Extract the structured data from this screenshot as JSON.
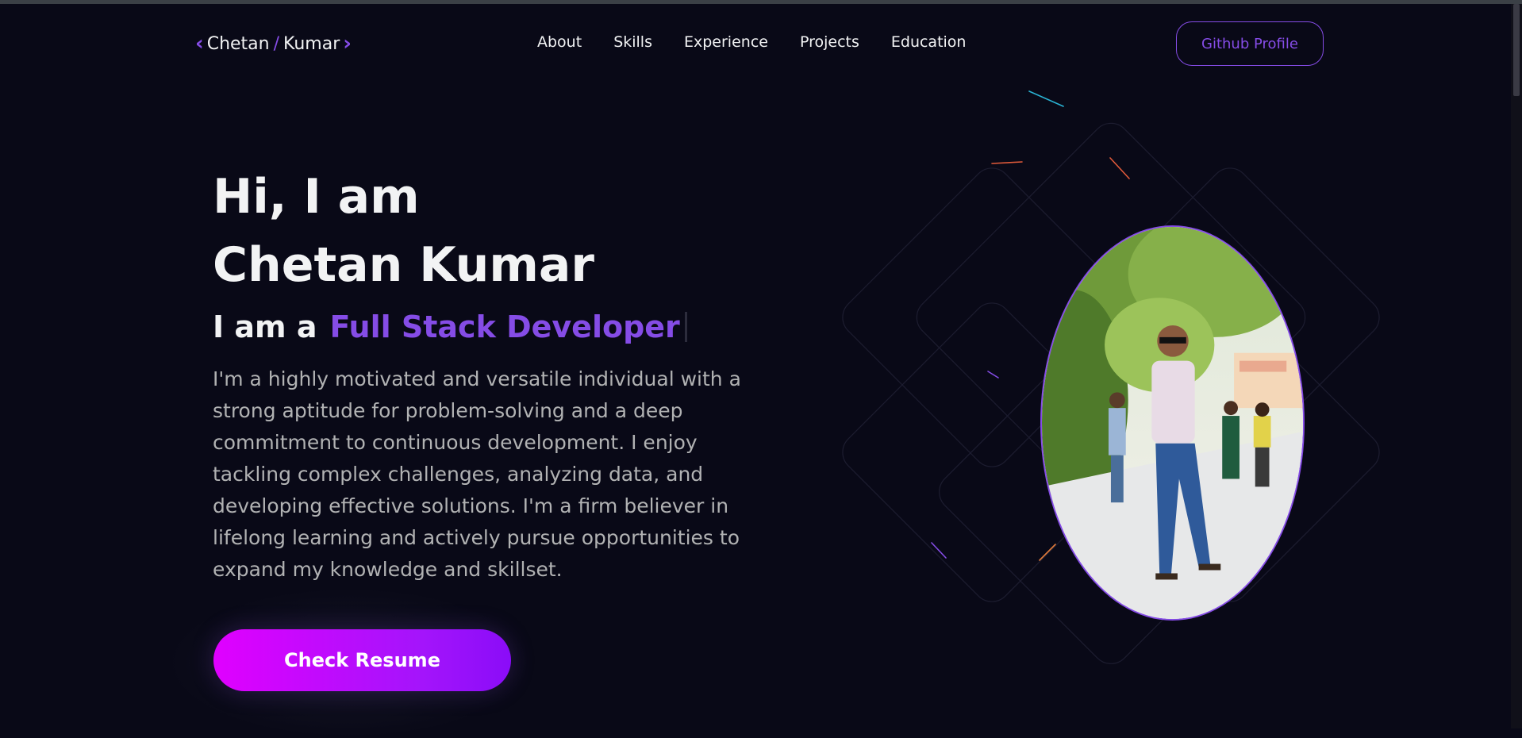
{
  "nav": {
    "logo_first": "Chetan",
    "logo_last": "Kumar",
    "links": [
      "About",
      "Skills",
      "Experience",
      "Projects",
      "Education"
    ],
    "github_button": "Github Profile"
  },
  "hero": {
    "greeting": "Hi, I am",
    "name": "Chetan Kumar",
    "role_prefix": "I am a",
    "role": "Full Stack Developer",
    "description": "I'm a highly motivated and versatile individual with a strong aptitude for problem-solving and a deep commitment to continuous development. I enjoy tackling complex challenges, analyzing data, and developing effective solutions. I'm a firm believer in lifelong learning and actively pursue opportunities to expand my knowledge and skillset.",
    "resume_button": "Check Resume"
  },
  "colors": {
    "background": "#090917",
    "primary": "#854ce6",
    "text_primary": "#f2f3f4",
    "text_secondary": "#b1b2b3"
  }
}
